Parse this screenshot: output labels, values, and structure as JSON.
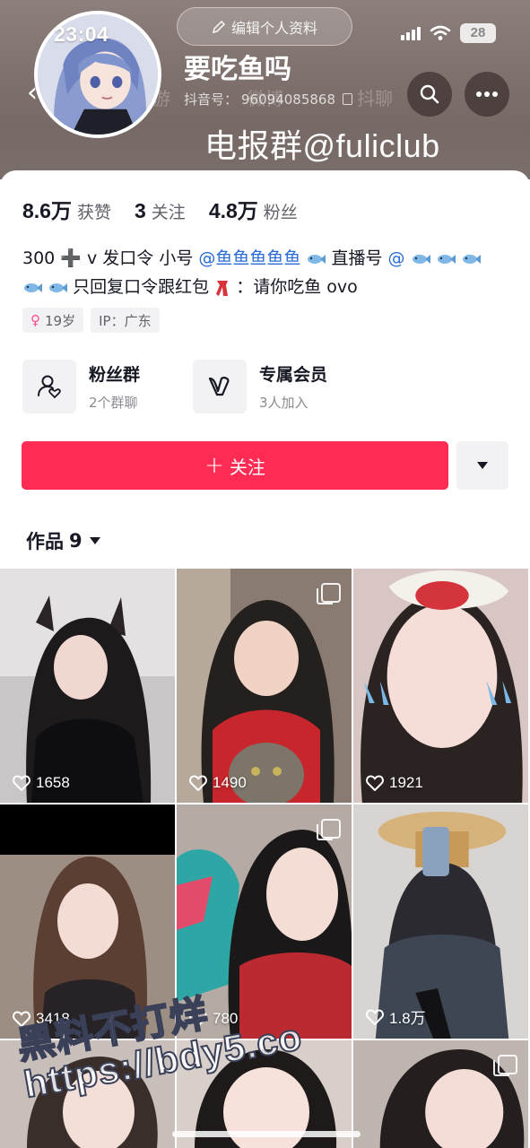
{
  "status_bar": {
    "time": "23:04",
    "battery": "28"
  },
  "header": {
    "edit_profile_label": "编辑个人资料",
    "nickname": "要吃鱼吗",
    "douyin_id_label": "抖音号：",
    "douyin_id": "96094085868",
    "watermark": "电报群@fuliclub"
  },
  "stats": [
    {
      "value": "8.6万",
      "label": "获赞"
    },
    {
      "value": "3",
      "label": "关注"
    },
    {
      "value": "4.8万",
      "label": "粉丝"
    }
  ],
  "bio": {
    "line1_a": "300 ➕ v 发口令 小号",
    "line1_mention": "@鱼鱼鱼鱼鱼",
    "line1_b": "直播号",
    "line1_at": "@",
    "line2": "只回复口令跟红包",
    "line2_b": "：请你吃鱼 ovo"
  },
  "tags": {
    "age": "19岁",
    "ip": "IP：广东"
  },
  "entries": [
    {
      "title": "粉丝群",
      "sub": "2个群聊"
    },
    {
      "title": "专属会员",
      "sub": "3人加入"
    }
  ],
  "follow_label": "关注",
  "works": {
    "label": "作品",
    "count": "9"
  },
  "grid": [
    {
      "likes": "1658"
    },
    {
      "likes": "1490"
    },
    {
      "likes": "1921"
    },
    {
      "likes": "3418"
    },
    {
      "likes": "780"
    },
    {
      "likes": "1.8万"
    }
  ],
  "bottom_watermark": {
    "line1": "黑料不打烊",
    "line2": "https://bdy5.co"
  },
  "colors": {
    "accent": "#fe2c55",
    "mention": "#2a6bd8"
  }
}
